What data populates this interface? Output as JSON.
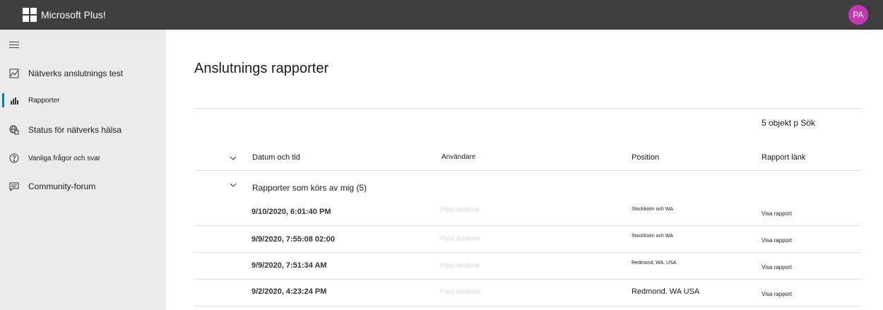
{
  "header": {
    "app_title": "Microsoft Plus!",
    "avatar_initials": "PA",
    "avatar_color": "#c239b3"
  },
  "sidebar": {
    "items": [
      {
        "label": "Nätverks anslutnings test",
        "icon": "chart-image-icon"
      },
      {
        "label": "Rapporter",
        "icon": "bar-chart-icon",
        "active": true
      },
      {
        "label": "Status för nätverks hälsa",
        "icon": "globe-network-icon"
      },
      {
        "label": "Vanliga frågor och svar",
        "icon": "question-circle-icon"
      },
      {
        "label": "Community-forum",
        "icon": "chat-icon"
      }
    ],
    "accent": "#0078d4"
  },
  "main": {
    "title": "Anslutnings rapporter",
    "count_text": "5 objekt p Sök",
    "columns": [
      "Datum och tid",
      "Användare",
      "Position",
      "Rapport länk"
    ],
    "group_label": "Rapporter som körs av mig (5)",
    "rows": [
      {
        "date": "9/10/2020, 6:01:40 PM",
        "user": "Paul Andrew",
        "position": "Stockholm och WA",
        "link": "Visa rapport"
      },
      {
        "date": "9/9/2020, 7:55:08 02:00",
        "user": "Paul Andrew",
        "position": "Stockholm och WA",
        "link": "Visa rapport"
      },
      {
        "date": "9/9/2020, 7:51:34 AM",
        "user": "Paul Andrew",
        "position": "Redmond, WA. USA",
        "link": "Visa rapport"
      },
      {
        "date": "9/2/2020, 4:23:24 PM",
        "user": "Paul Andrew",
        "position": "Redmond. WA USA",
        "link": "Visa rapport"
      }
    ]
  }
}
